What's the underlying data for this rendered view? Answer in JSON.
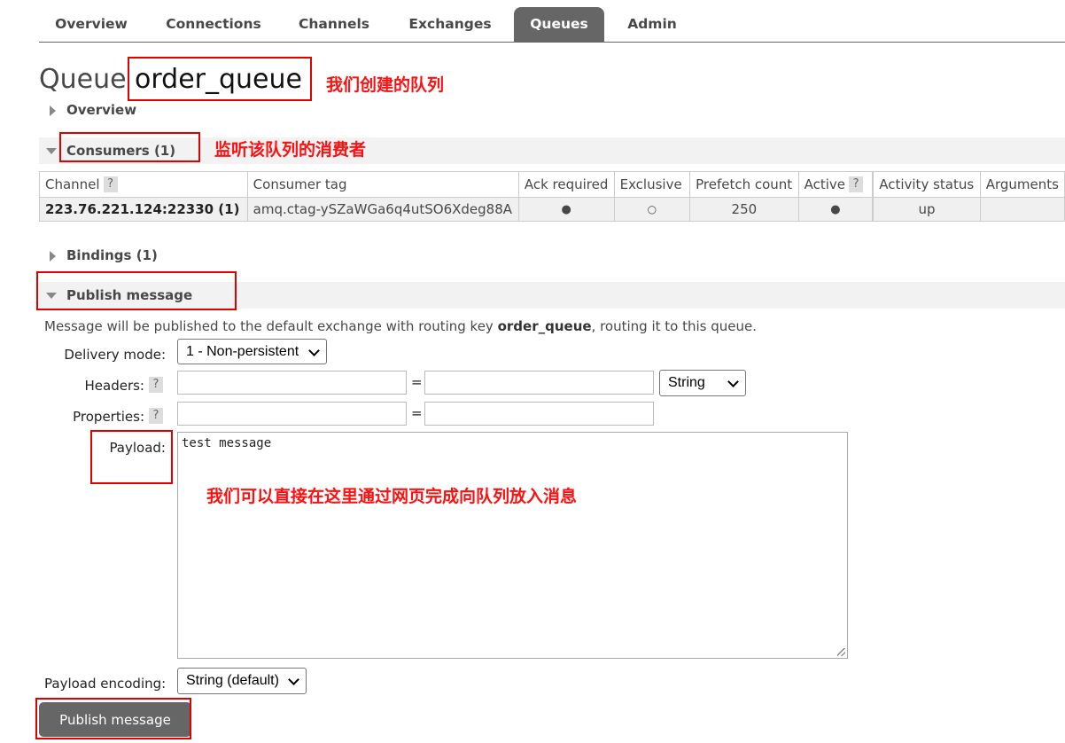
{
  "nav": {
    "tabs": [
      "Overview",
      "Connections",
      "Channels",
      "Exchanges",
      "Queues",
      "Admin"
    ],
    "active": "Queues"
  },
  "title": {
    "prefix": "Queue",
    "name": "order_queue"
  },
  "annotations": {
    "queue": "我们创建的队列",
    "consumers": "监听该队列的消费者",
    "payload": "我们可以直接在这里通过网页完成向队列放入消息"
  },
  "sections": {
    "overview": "Overview",
    "consumers": "Consumers (1)",
    "bindings": "Bindings (1)",
    "publish": "Publish message"
  },
  "consumers_table": {
    "headers": [
      "Channel",
      "Consumer tag",
      "Ack required",
      "Exclusive",
      "Prefetch count",
      "Active",
      "Activity status",
      "Arguments"
    ],
    "help_mark": "?",
    "row": {
      "channel": "223.76.221.124:22330 (1)",
      "consumer_tag": "amq.ctag-ySZaWGa6q4utSO6Xdeg88A",
      "ack_required": "●",
      "exclusive": "○",
      "prefetch_count": "250",
      "active": "●",
      "activity_status": "up",
      "arguments": ""
    }
  },
  "publish": {
    "info_prefix": "Message will be published to the default exchange with routing key ",
    "info_key": "order_queue",
    "info_suffix": ", routing it to this queue.",
    "delivery_mode_label": "Delivery mode:",
    "delivery_mode_value": "1 - Non-persistent",
    "headers_label": "Headers:",
    "headers_type": "String",
    "properties_label": "Properties:",
    "payload_label": "Payload:",
    "payload_value": "test message",
    "encoding_label": "Payload encoding:",
    "encoding_value": "String (default)",
    "submit_label": "Publish message",
    "equals": "="
  }
}
